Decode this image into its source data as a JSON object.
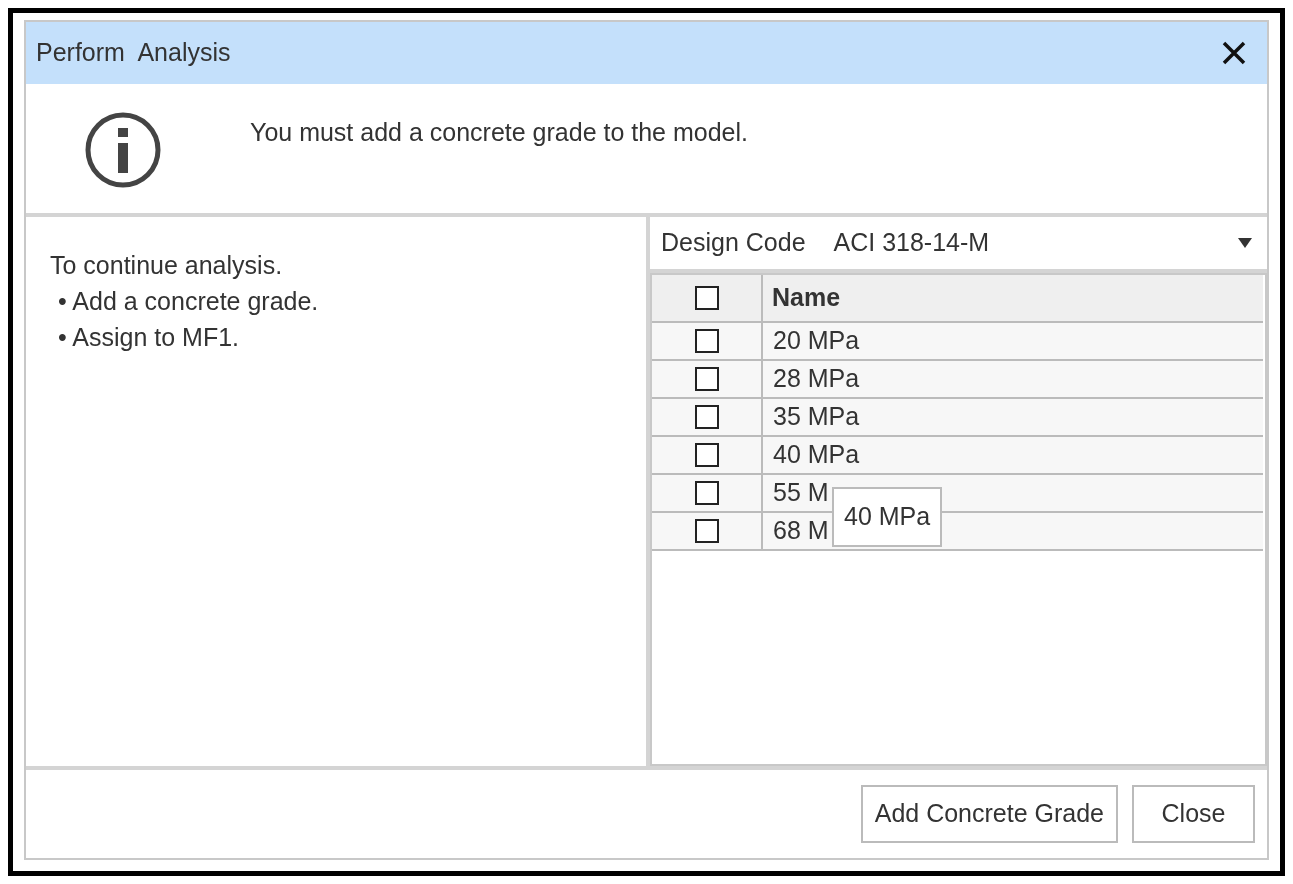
{
  "dialog": {
    "title": "Perform  Analysis",
    "message": "You must add a concrete grade to the model."
  },
  "instructions": {
    "heading": "To continue analysis.",
    "bullets": [
      "• Add a concrete grade.",
      "• Assign to MF1."
    ]
  },
  "design_code": {
    "label": "Design Code",
    "value": "ACI 318-14-M"
  },
  "table": {
    "header_checked": false,
    "columns": [
      "Name"
    ],
    "rows": [
      {
        "name": "20 MPa",
        "checked": false
      },
      {
        "name": "28 MPa",
        "checked": false
      },
      {
        "name": "35 MPa",
        "checked": false
      },
      {
        "name": "40 MPa",
        "checked": false
      },
      {
        "name": "55 M",
        "checked": false
      },
      {
        "name": "68 M",
        "checked": false
      }
    ]
  },
  "tooltip": "40 MPa",
  "buttons": [
    "Add Concrete Grade",
    "Close"
  ]
}
